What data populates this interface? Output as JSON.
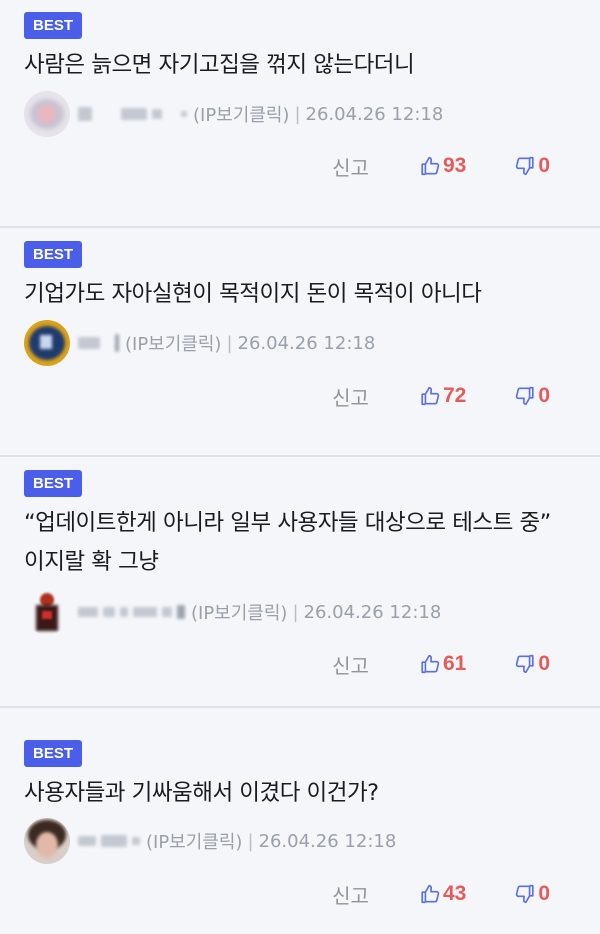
{
  "comments": [
    {
      "badge": "BEST",
      "text": "사람은 늙으면 자기고집을 꺾지 않는다더니",
      "ip_info": "(IP보기클릭)",
      "separator": "|",
      "date": "26.04.26 12:18",
      "report_label": "신고",
      "likes": "93",
      "dislikes": "0"
    },
    {
      "badge": "BEST",
      "text": "기업가도 자아실현이 목적이지 돈이 목적이 아니다",
      "ip_info": "(IP보기클릭)",
      "separator": "|",
      "date": "26.04.26 12:18",
      "report_label": "신고",
      "likes": "72",
      "dislikes": "0"
    },
    {
      "badge": "BEST",
      "text": "“업데이트한게 아니라 일부 사용자들 대상으로 테스트 중” 이지랄 확 그냥",
      "ip_info": "(IP보기클릭)",
      "separator": "|",
      "date": "26.04.26 12:18",
      "report_label": "신고",
      "likes": "61",
      "dislikes": "0"
    },
    {
      "badge": "BEST",
      "text": "사용자들과 기싸움해서 이겼다 이건가?",
      "ip_info": "(IP보기클릭)",
      "separator": "|",
      "date": "26.04.26 12:18",
      "report_label": "신고",
      "likes": "43",
      "dislikes": "0"
    }
  ],
  "colors": {
    "badge_bg": "#4b5ee9",
    "thumb_up": "#5a6fe8",
    "count": "#e85a5a",
    "meta_text": "#9aa0ab",
    "divider": "#dde1ea",
    "background": "#f4f6fa"
  },
  "icons": [
    "thumbs-up-icon",
    "thumbs-down-icon"
  ]
}
